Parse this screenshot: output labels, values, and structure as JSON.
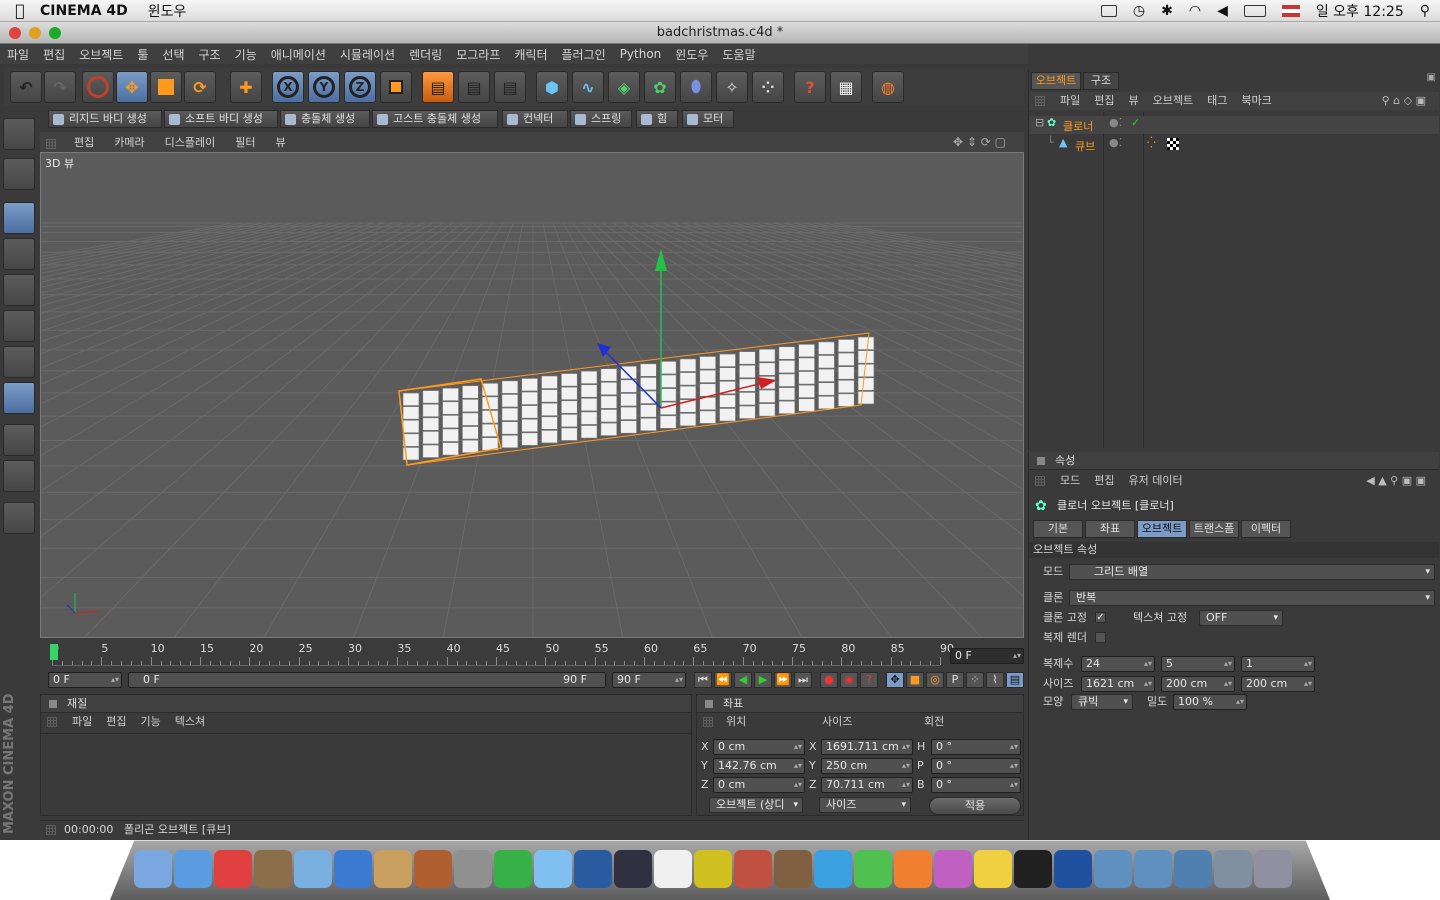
{
  "os_menubar": {
    "app_name": "CINEMA 4D",
    "menu_window": "윈도우",
    "clock": "일 오후 12:25"
  },
  "window": {
    "title": "badchristmas.c4d *"
  },
  "main_menu": [
    "파일",
    "편집",
    "오브젝트",
    "툴",
    "선택",
    "구조",
    "기능",
    "애니메이션",
    "시뮬레이션",
    "렌더링",
    "모그라프",
    "캐릭터",
    "플러그인",
    "Python",
    "윈도우",
    "도움말"
  ],
  "dynamics_bar": [
    "리지드 바디 생성",
    "소프트 바디 생성",
    "충돌체 생성",
    "고스트 충돌체 생성",
    "컨넥터",
    "스프링",
    "힘",
    "모터"
  ],
  "toolbar_axes": [
    "X",
    "Y",
    "Z"
  ],
  "viewport": {
    "menu": [
      "편집",
      "카메라",
      "디스플레이",
      "필터",
      "뷰"
    ],
    "label": "3D 뷰"
  },
  "timeline": {
    "ticks": [
      "0",
      "5",
      "10",
      "15",
      "20",
      "25",
      "30",
      "35",
      "40",
      "45",
      "50",
      "55",
      "60",
      "65",
      "70",
      "75",
      "80",
      "85",
      "90"
    ],
    "current_frame": "0 F",
    "start_field": "0 F",
    "range_start": "0 F",
    "range_end": "90 F",
    "end_field": "90 F"
  },
  "material_panel": {
    "title": "재질",
    "menu": [
      "파일",
      "편집",
      "기능",
      "텍스쳐"
    ]
  },
  "coord_panel": {
    "title": "좌표",
    "col_headers": [
      "위치",
      "사이즈",
      "회전"
    ],
    "rows": [
      {
        "axis": "X",
        "pos": "0 cm",
        "size_axis": "X",
        "size": "1691.711 cm",
        "rot_axis": "H",
        "rot": "0 °"
      },
      {
        "axis": "Y",
        "pos": "142.76 cm",
        "size_axis": "Y",
        "size": "250 cm",
        "rot_axis": "P",
        "rot": "0 °"
      },
      {
        "axis": "Z",
        "pos": "0 cm",
        "size_axis": "Z",
        "size": "70.711 cm",
        "rot_axis": "B",
        "rot": "0 °"
      }
    ],
    "mode_select": "오브젝트 (상디",
    "size_select": "사이즈",
    "apply": "적용"
  },
  "statusbar": {
    "time": "00:00:00",
    "message": "폴리곤 오브젝트 [큐브]"
  },
  "brand": "MAXON CINEMA 4D",
  "object_manager": {
    "tabs": [
      "오브젝트",
      "구조"
    ],
    "menu": [
      "파일",
      "편집",
      "뷰",
      "오브젝트",
      "태그",
      "북마크"
    ],
    "items": [
      {
        "name": "클로너",
        "level": 0
      },
      {
        "name": "큐브",
        "level": 1
      }
    ]
  },
  "attributes": {
    "title": "속성",
    "menu": [
      "모드",
      "편집",
      "유저 데이터"
    ],
    "object_title": "클로너 오브젝트 [클로너]",
    "tabs": [
      "기본",
      "좌표",
      "오브젝트",
      "트랜스폼",
      "이펙터"
    ],
    "section": "오브젝트 속성",
    "mode_label": "모드",
    "mode_value": "그리드 배열",
    "clone_label": "클론",
    "clone_value": "반복",
    "fix_clone_label": "클론 고정",
    "fix_texture_label": "텍스쳐 고정",
    "fix_texture_value": "OFF",
    "render_instance_label": "복제 렌더",
    "count_label": "복제수",
    "count_values": [
      "24",
      "5",
      "1"
    ],
    "size_label": "사이즈",
    "size_values": [
      "1621 cm",
      "200 cm",
      "200 cm"
    ],
    "shape_label": "모양",
    "shape_value": "큐빅",
    "density_label": "밀도",
    "density_value": "100 %"
  },
  "colors": {
    "accent": "#7a9cc6",
    "selection_orange": "#ff9a1f",
    "bg_panel": "#3a3a3a",
    "viewport_bg": "#5b5b5b"
  }
}
